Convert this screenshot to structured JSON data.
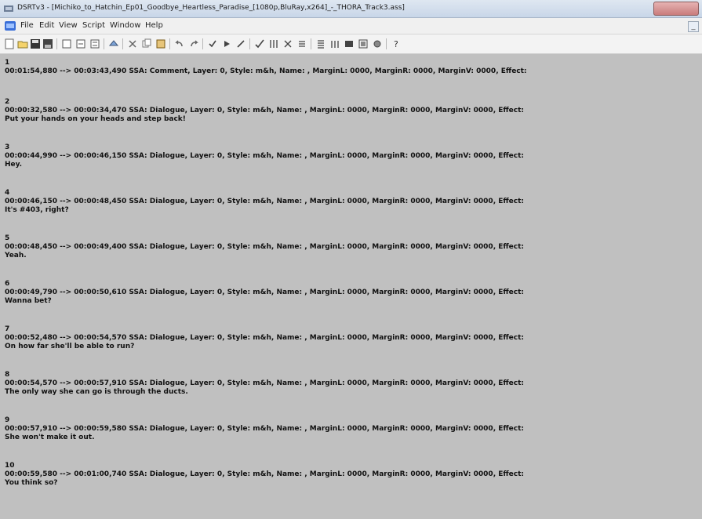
{
  "window": {
    "title": "DSRTv3 - [Michiko_to_Hatchin_Ep01_Goodbye_Heartless_Paradise_[1080p,BluRay,x264]_-_THORA_Track3.ass]"
  },
  "menu": {
    "items": [
      "File",
      "Edit",
      "View",
      "Script",
      "Window",
      "Help"
    ]
  },
  "toolbar": {
    "icons": [
      "new-icon",
      "open-icon",
      "save-icon",
      "save-all-icon",
      "page-icon",
      "page2-icon",
      "page3-icon",
      "load-icon",
      "cut-icon",
      "copy-icon",
      "paste-icon",
      "undo-icon",
      "redo-icon",
      "check-icon",
      "play-icon",
      "wand-icon",
      "tick-icon",
      "columns-icon",
      "cross-icon",
      "list-icon",
      "list2-icon",
      "bars-icon",
      "grid-icon",
      "frame-icon",
      "settings-icon",
      "help-icon"
    ]
  },
  "subtitles": [
    {
      "index": "1",
      "timing": "00:01:54,880 --> 00:03:43,490  SSA: Comment, Layer: 0, Style: m&h, Name: , MarginL: 0000, MarginR: 0000, MarginV: 0000, Effect:",
      "text": ""
    },
    {
      "index": "2",
      "timing": "00:00:32,580 --> 00:00:34,470  SSA: Dialogue, Layer: 0, Style: m&h, Name: , MarginL: 0000, MarginR: 0000, MarginV: 0000, Effect:",
      "text": "Put your hands on your heads and step back!"
    },
    {
      "index": "3",
      "timing": "00:00:44,990 --> 00:00:46,150  SSA: Dialogue, Layer: 0, Style: m&h, Name: , MarginL: 0000, MarginR: 0000, MarginV: 0000, Effect:",
      "text": "Hey."
    },
    {
      "index": "4",
      "timing": "00:00:46,150 --> 00:00:48,450  SSA: Dialogue, Layer: 0, Style: m&h, Name: , MarginL: 0000, MarginR: 0000, MarginV: 0000, Effect:",
      "text": "It's #403, right?"
    },
    {
      "index": "5",
      "timing": "00:00:48,450 --> 00:00:49,400  SSA: Dialogue, Layer: 0, Style: m&h, Name: , MarginL: 0000, MarginR: 0000, MarginV: 0000, Effect:",
      "text": "Yeah."
    },
    {
      "index": "6",
      "timing": "00:00:49,790 --> 00:00:50,610  SSA: Dialogue, Layer: 0, Style: m&h, Name: , MarginL: 0000, MarginR: 0000, MarginV: 0000, Effect:",
      "text": "Wanna bet?"
    },
    {
      "index": "7",
      "timing": "00:00:52,480 --> 00:00:54,570  SSA: Dialogue, Layer: 0, Style: m&h, Name: , MarginL: 0000, MarginR: 0000, MarginV: 0000, Effect:",
      "text": "On how far she'll be able to run?"
    },
    {
      "index": "8",
      "timing": "00:00:54,570 --> 00:00:57,910  SSA: Dialogue, Layer: 0, Style: m&h, Name: , MarginL: 0000, MarginR: 0000, MarginV: 0000, Effect:",
      "text": "The only way she can go is through the ducts."
    },
    {
      "index": "9",
      "timing": "00:00:57,910 --> 00:00:59,580  SSA: Dialogue, Layer: 0, Style: m&h, Name: , MarginL: 0000, MarginR: 0000, MarginV: 0000, Effect:",
      "text": "She won't make it out."
    },
    {
      "index": "10",
      "timing": "00:00:59,580 --> 00:01:00,740  SSA: Dialogue, Layer: 0, Style: m&h, Name: , MarginL: 0000, MarginR: 0000, MarginV: 0000, Effect:",
      "text": "You think so?"
    }
  ]
}
